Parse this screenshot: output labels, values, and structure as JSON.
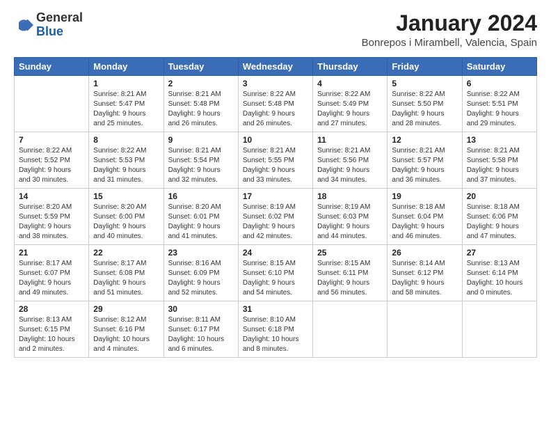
{
  "logo": {
    "general": "General",
    "blue": "Blue"
  },
  "title": "January 2024",
  "location": "Bonrepos i Mirambell, Valencia, Spain",
  "days_of_week": [
    "Sunday",
    "Monday",
    "Tuesday",
    "Wednesday",
    "Thursday",
    "Friday",
    "Saturday"
  ],
  "weeks": [
    [
      {
        "day": "",
        "content": ""
      },
      {
        "day": "1",
        "content": "Sunrise: 8:21 AM\nSunset: 5:47 PM\nDaylight: 9 hours\nand 25 minutes."
      },
      {
        "day": "2",
        "content": "Sunrise: 8:21 AM\nSunset: 5:48 PM\nDaylight: 9 hours\nand 26 minutes."
      },
      {
        "day": "3",
        "content": "Sunrise: 8:22 AM\nSunset: 5:48 PM\nDaylight: 9 hours\nand 26 minutes."
      },
      {
        "day": "4",
        "content": "Sunrise: 8:22 AM\nSunset: 5:49 PM\nDaylight: 9 hours\nand 27 minutes."
      },
      {
        "day": "5",
        "content": "Sunrise: 8:22 AM\nSunset: 5:50 PM\nDaylight: 9 hours\nand 28 minutes."
      },
      {
        "day": "6",
        "content": "Sunrise: 8:22 AM\nSunset: 5:51 PM\nDaylight: 9 hours\nand 29 minutes."
      }
    ],
    [
      {
        "day": "7",
        "content": "Sunrise: 8:22 AM\nSunset: 5:52 PM\nDaylight: 9 hours\nand 30 minutes."
      },
      {
        "day": "8",
        "content": "Sunrise: 8:22 AM\nSunset: 5:53 PM\nDaylight: 9 hours\nand 31 minutes."
      },
      {
        "day": "9",
        "content": "Sunrise: 8:21 AM\nSunset: 5:54 PM\nDaylight: 9 hours\nand 32 minutes."
      },
      {
        "day": "10",
        "content": "Sunrise: 8:21 AM\nSunset: 5:55 PM\nDaylight: 9 hours\nand 33 minutes."
      },
      {
        "day": "11",
        "content": "Sunrise: 8:21 AM\nSunset: 5:56 PM\nDaylight: 9 hours\nand 34 minutes."
      },
      {
        "day": "12",
        "content": "Sunrise: 8:21 AM\nSunset: 5:57 PM\nDaylight: 9 hours\nand 36 minutes."
      },
      {
        "day": "13",
        "content": "Sunrise: 8:21 AM\nSunset: 5:58 PM\nDaylight: 9 hours\nand 37 minutes."
      }
    ],
    [
      {
        "day": "14",
        "content": "Sunrise: 8:20 AM\nSunset: 5:59 PM\nDaylight: 9 hours\nand 38 minutes."
      },
      {
        "day": "15",
        "content": "Sunrise: 8:20 AM\nSunset: 6:00 PM\nDaylight: 9 hours\nand 40 minutes."
      },
      {
        "day": "16",
        "content": "Sunrise: 8:20 AM\nSunset: 6:01 PM\nDaylight: 9 hours\nand 41 minutes."
      },
      {
        "day": "17",
        "content": "Sunrise: 8:19 AM\nSunset: 6:02 PM\nDaylight: 9 hours\nand 42 minutes."
      },
      {
        "day": "18",
        "content": "Sunrise: 8:19 AM\nSunset: 6:03 PM\nDaylight: 9 hours\nand 44 minutes."
      },
      {
        "day": "19",
        "content": "Sunrise: 8:18 AM\nSunset: 6:04 PM\nDaylight: 9 hours\nand 46 minutes."
      },
      {
        "day": "20",
        "content": "Sunrise: 8:18 AM\nSunset: 6:06 PM\nDaylight: 9 hours\nand 47 minutes."
      }
    ],
    [
      {
        "day": "21",
        "content": "Sunrise: 8:17 AM\nSunset: 6:07 PM\nDaylight: 9 hours\nand 49 minutes."
      },
      {
        "day": "22",
        "content": "Sunrise: 8:17 AM\nSunset: 6:08 PM\nDaylight: 9 hours\nand 51 minutes."
      },
      {
        "day": "23",
        "content": "Sunrise: 8:16 AM\nSunset: 6:09 PM\nDaylight: 9 hours\nand 52 minutes."
      },
      {
        "day": "24",
        "content": "Sunrise: 8:15 AM\nSunset: 6:10 PM\nDaylight: 9 hours\nand 54 minutes."
      },
      {
        "day": "25",
        "content": "Sunrise: 8:15 AM\nSunset: 6:11 PM\nDaylight: 9 hours\nand 56 minutes."
      },
      {
        "day": "26",
        "content": "Sunrise: 8:14 AM\nSunset: 6:12 PM\nDaylight: 9 hours\nand 58 minutes."
      },
      {
        "day": "27",
        "content": "Sunrise: 8:13 AM\nSunset: 6:14 PM\nDaylight: 10 hours\nand 0 minutes."
      }
    ],
    [
      {
        "day": "28",
        "content": "Sunrise: 8:13 AM\nSunset: 6:15 PM\nDaylight: 10 hours\nand 2 minutes."
      },
      {
        "day": "29",
        "content": "Sunrise: 8:12 AM\nSunset: 6:16 PM\nDaylight: 10 hours\nand 4 minutes."
      },
      {
        "day": "30",
        "content": "Sunrise: 8:11 AM\nSunset: 6:17 PM\nDaylight: 10 hours\nand 6 minutes."
      },
      {
        "day": "31",
        "content": "Sunrise: 8:10 AM\nSunset: 6:18 PM\nDaylight: 10 hours\nand 8 minutes."
      },
      {
        "day": "",
        "content": ""
      },
      {
        "day": "",
        "content": ""
      },
      {
        "day": "",
        "content": ""
      }
    ]
  ]
}
